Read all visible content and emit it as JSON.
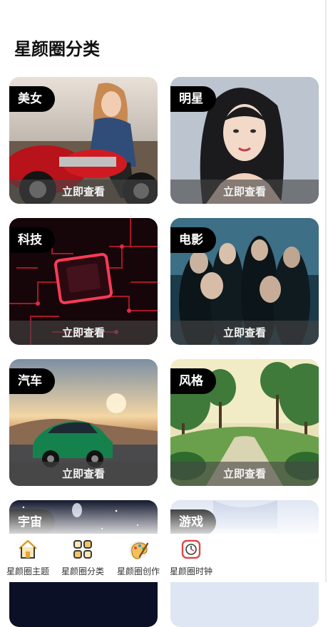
{
  "page": {
    "title": "星颜圈分类"
  },
  "categories": [
    {
      "name": "美女",
      "action": "立即查看",
      "image": "woman-on-motorcycle"
    },
    {
      "name": "明星",
      "action": "立即查看",
      "image": "celebrity-portrait"
    },
    {
      "name": "科技",
      "action": "立即查看",
      "image": "glowing-circuit-chip"
    },
    {
      "name": "电影",
      "action": "立即查看",
      "image": "movie-poster-characters"
    },
    {
      "name": "汽车",
      "action": "立即查看",
      "image": "green-sports-car"
    },
    {
      "name": "风格",
      "action": "立即查看",
      "image": "illustrated-forest-path"
    },
    {
      "name": "宇宙",
      "action": "",
      "image": "starry-galaxy"
    },
    {
      "name": "游戏",
      "action": "",
      "image": "game-art"
    }
  ],
  "tabbar": {
    "items": [
      {
        "label": "星颜圈主题",
        "icon": "home-icon"
      },
      {
        "label": "星颜圈分类",
        "icon": "grid-icon"
      },
      {
        "label": "星颜圈创作",
        "icon": "palette-icon"
      },
      {
        "label": "星颜圈时钟",
        "icon": "clock-icon"
      }
    ]
  },
  "colors": {
    "tag_background": "#000000",
    "overlay": "#464646",
    "icon_accent": "#e8a33a",
    "clock_accent": "#e04848"
  }
}
